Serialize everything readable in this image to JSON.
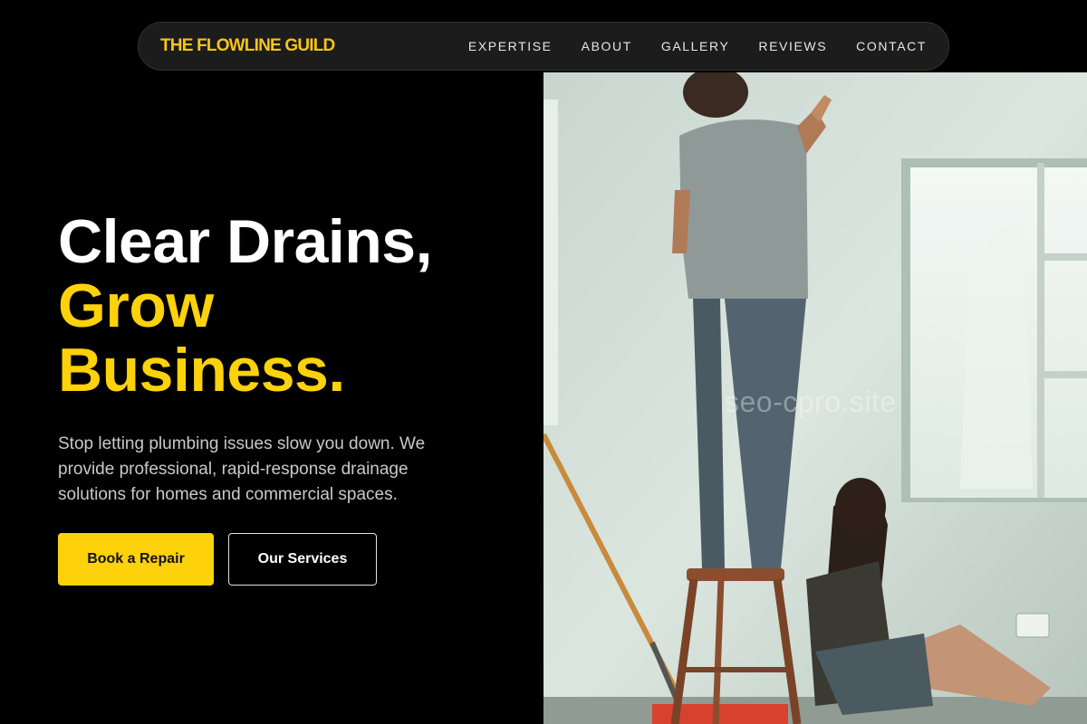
{
  "nav": {
    "brand": "THE FLOWLINE GUILD",
    "links": [
      "EXPERTISE",
      "ABOUT",
      "GALLERY",
      "REVIEWS",
      "CONTACT"
    ]
  },
  "hero": {
    "headline_line1": "Clear Drains,",
    "headline_line2": "Grow",
    "headline_line3": "Business.",
    "subtext": "Stop letting plumbing issues slow you down. We provide professional, rapid-response drainage solutions for homes and commercial spaces.",
    "primary_button": "Book a Repair",
    "secondary_button": "Our Services"
  },
  "image": {
    "watermark": "seo-cpro.site"
  },
  "colors": {
    "accent": "#fdd20a",
    "background": "#000000",
    "nav_bg": "#1c1c1c"
  }
}
